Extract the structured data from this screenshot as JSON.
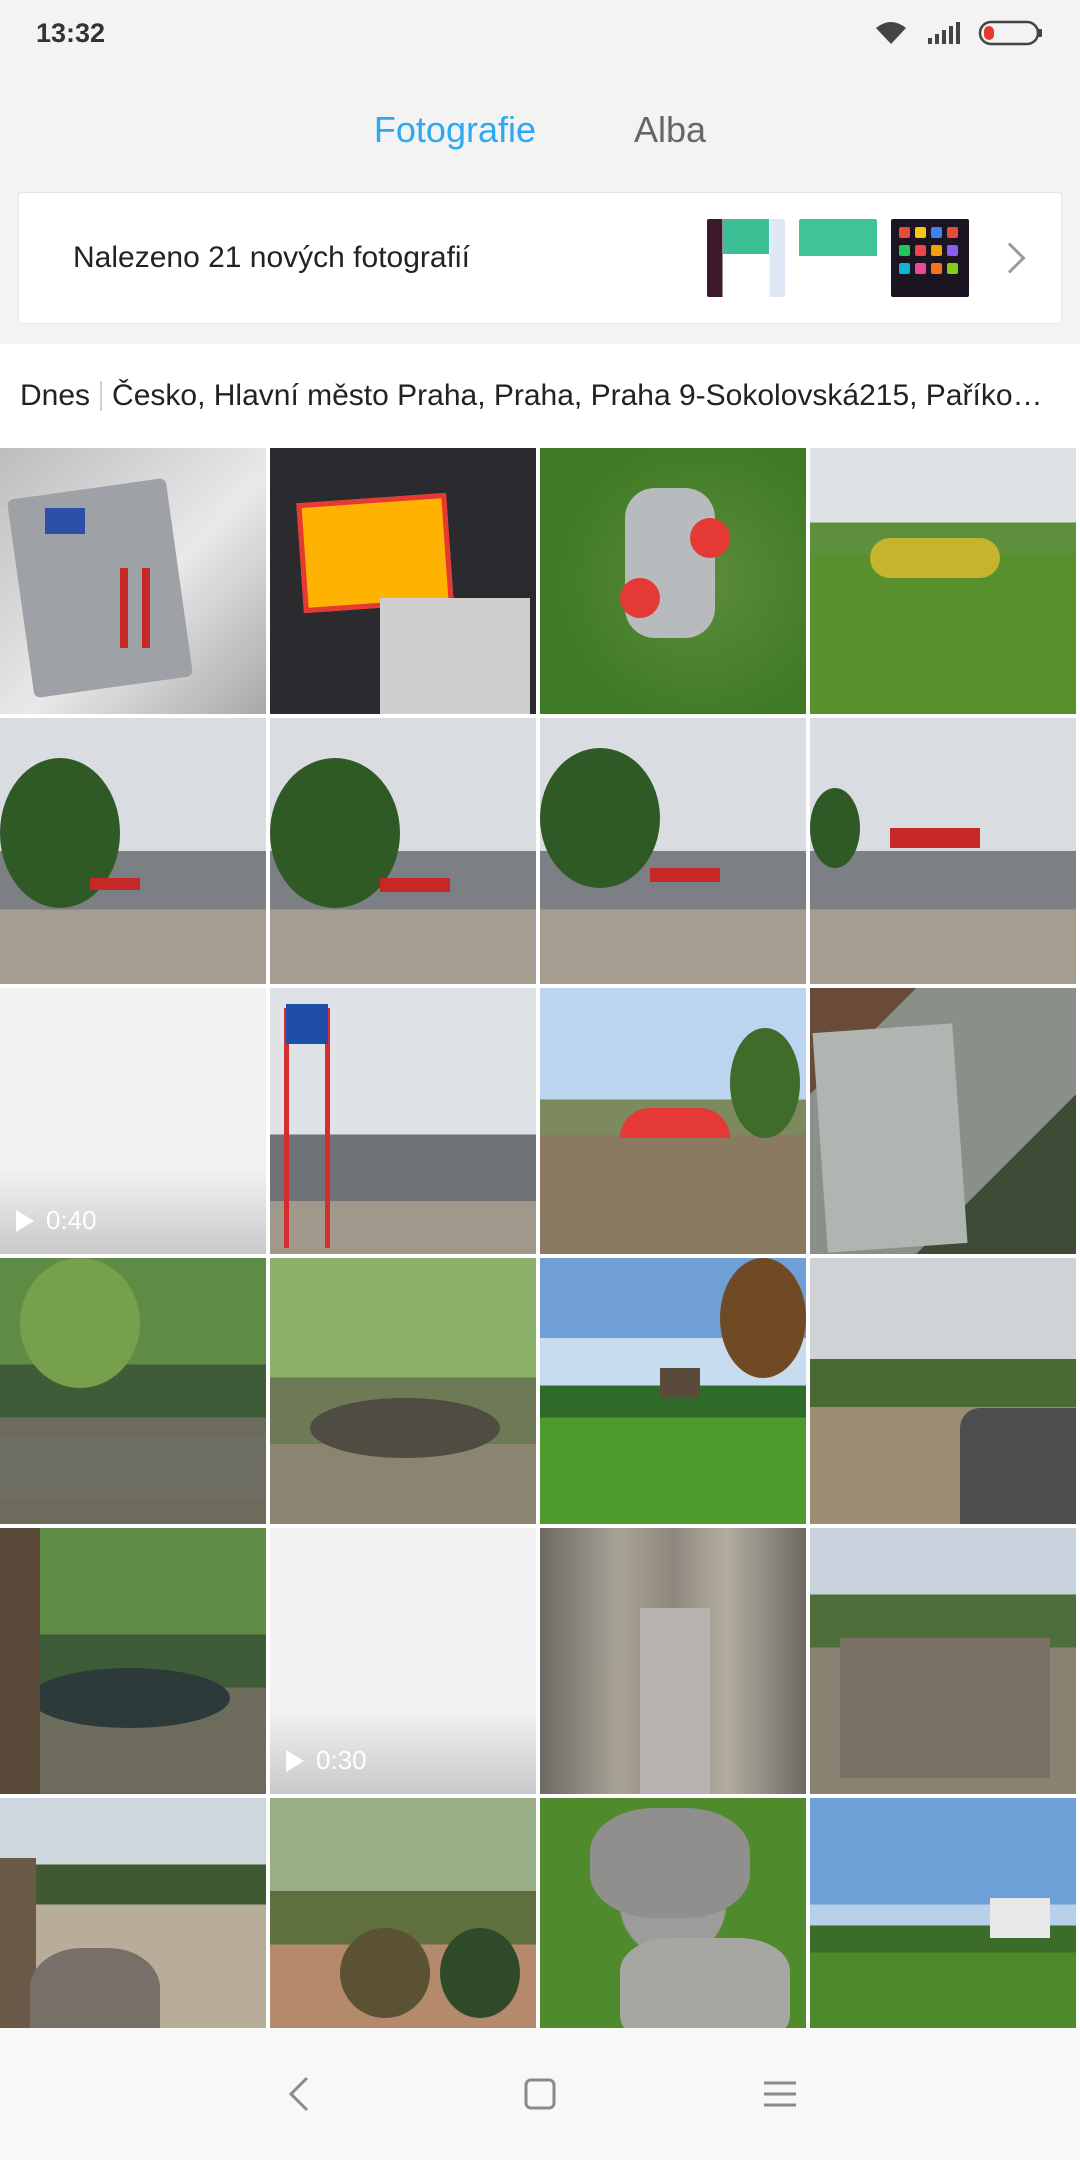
{
  "status_bar": {
    "time": "13:32"
  },
  "tabs": [
    {
      "label": "Fotografie",
      "active": true
    },
    {
      "label": "Alba",
      "active": false
    }
  ],
  "new_photos": {
    "text": "Nalezeno 21 nových fotografií"
  },
  "section": {
    "date": "Dnes",
    "location": "Česko, Hlavní město Praha, Praha, Praha 9-Sokolovská215, Paříko…"
  },
  "grid": {
    "videos": [
      {
        "duration": "0:40"
      },
      {
        "duration": "0:30"
      }
    ]
  },
  "colors": {
    "accent": "#2ea8f0",
    "background": "#f3f3f3"
  },
  "nav": {
    "back_icon": "back-icon",
    "home_icon": "home-icon",
    "menu_icon": "menu-icon"
  }
}
